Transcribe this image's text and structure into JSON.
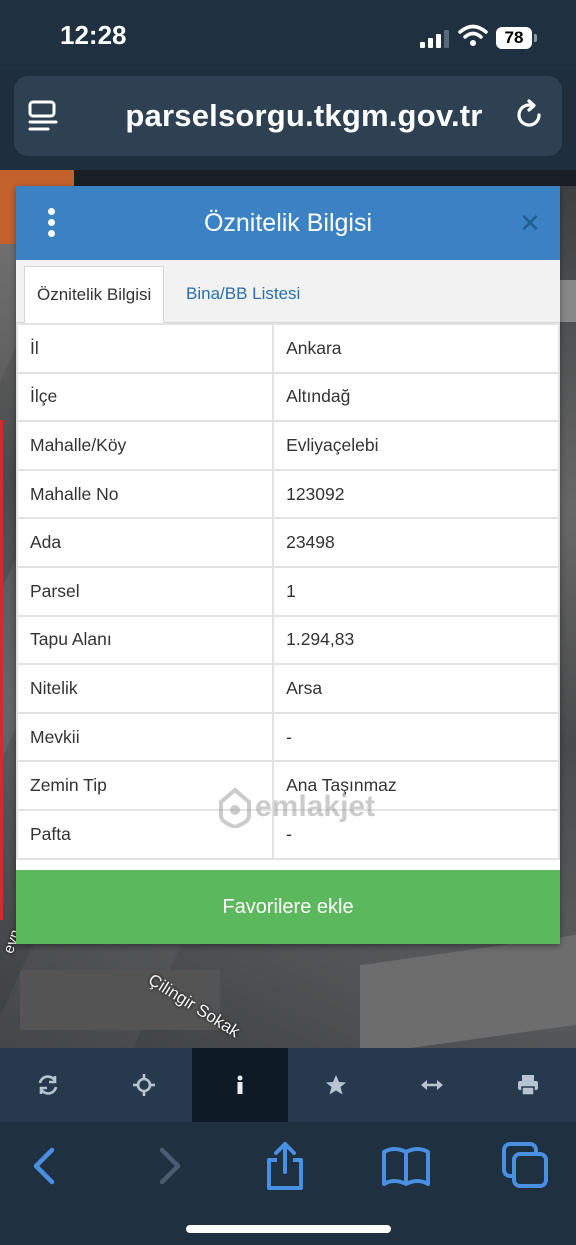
{
  "status_bar": {
    "time": "12:28",
    "battery": "78"
  },
  "browser": {
    "url": "parselsorgu.tkgm.gov.tr"
  },
  "map": {
    "street_label": "Çilingir Sokak",
    "street_label_2": "evn"
  },
  "modal": {
    "title": "Öznitelik Bilgisi",
    "tabs": [
      {
        "label": "Öznitelik Bilgisi",
        "active": true
      },
      {
        "label": "Bina/BB Listesi",
        "active": false
      }
    ],
    "rows": [
      {
        "key": "İl",
        "value": "Ankara"
      },
      {
        "key": "İlçe",
        "value": "Altındağ"
      },
      {
        "key": "Mahalle/Köy",
        "value": "Evliyaçelebi"
      },
      {
        "key": "Mahalle No",
        "value": "123092"
      },
      {
        "key": "Ada",
        "value": "23498"
      },
      {
        "key": "Parsel",
        "value": "1"
      },
      {
        "key": "Tapu Alanı",
        "value": "1.294,83"
      },
      {
        "key": "Nitelik",
        "value": "Arsa"
      },
      {
        "key": "Mevkii",
        "value": "-"
      },
      {
        "key": "Zemin Tip",
        "value": "Ana Taşınmaz"
      },
      {
        "key": "Pafta",
        "value": "-"
      }
    ],
    "favorite_button": "Favorilere ekle"
  },
  "watermark": {
    "text": "emlakjet"
  },
  "toolbar": {
    "items": [
      "refresh-icon",
      "locate-icon",
      "info-icon",
      "star-icon",
      "measure-icon",
      "print-icon"
    ],
    "active": "info-icon"
  },
  "colors": {
    "header_blue": "#3a82c3",
    "button_green": "#5cb85c",
    "link_blue": "#2a6fa8",
    "safari_accent": "#4a90e2"
  }
}
